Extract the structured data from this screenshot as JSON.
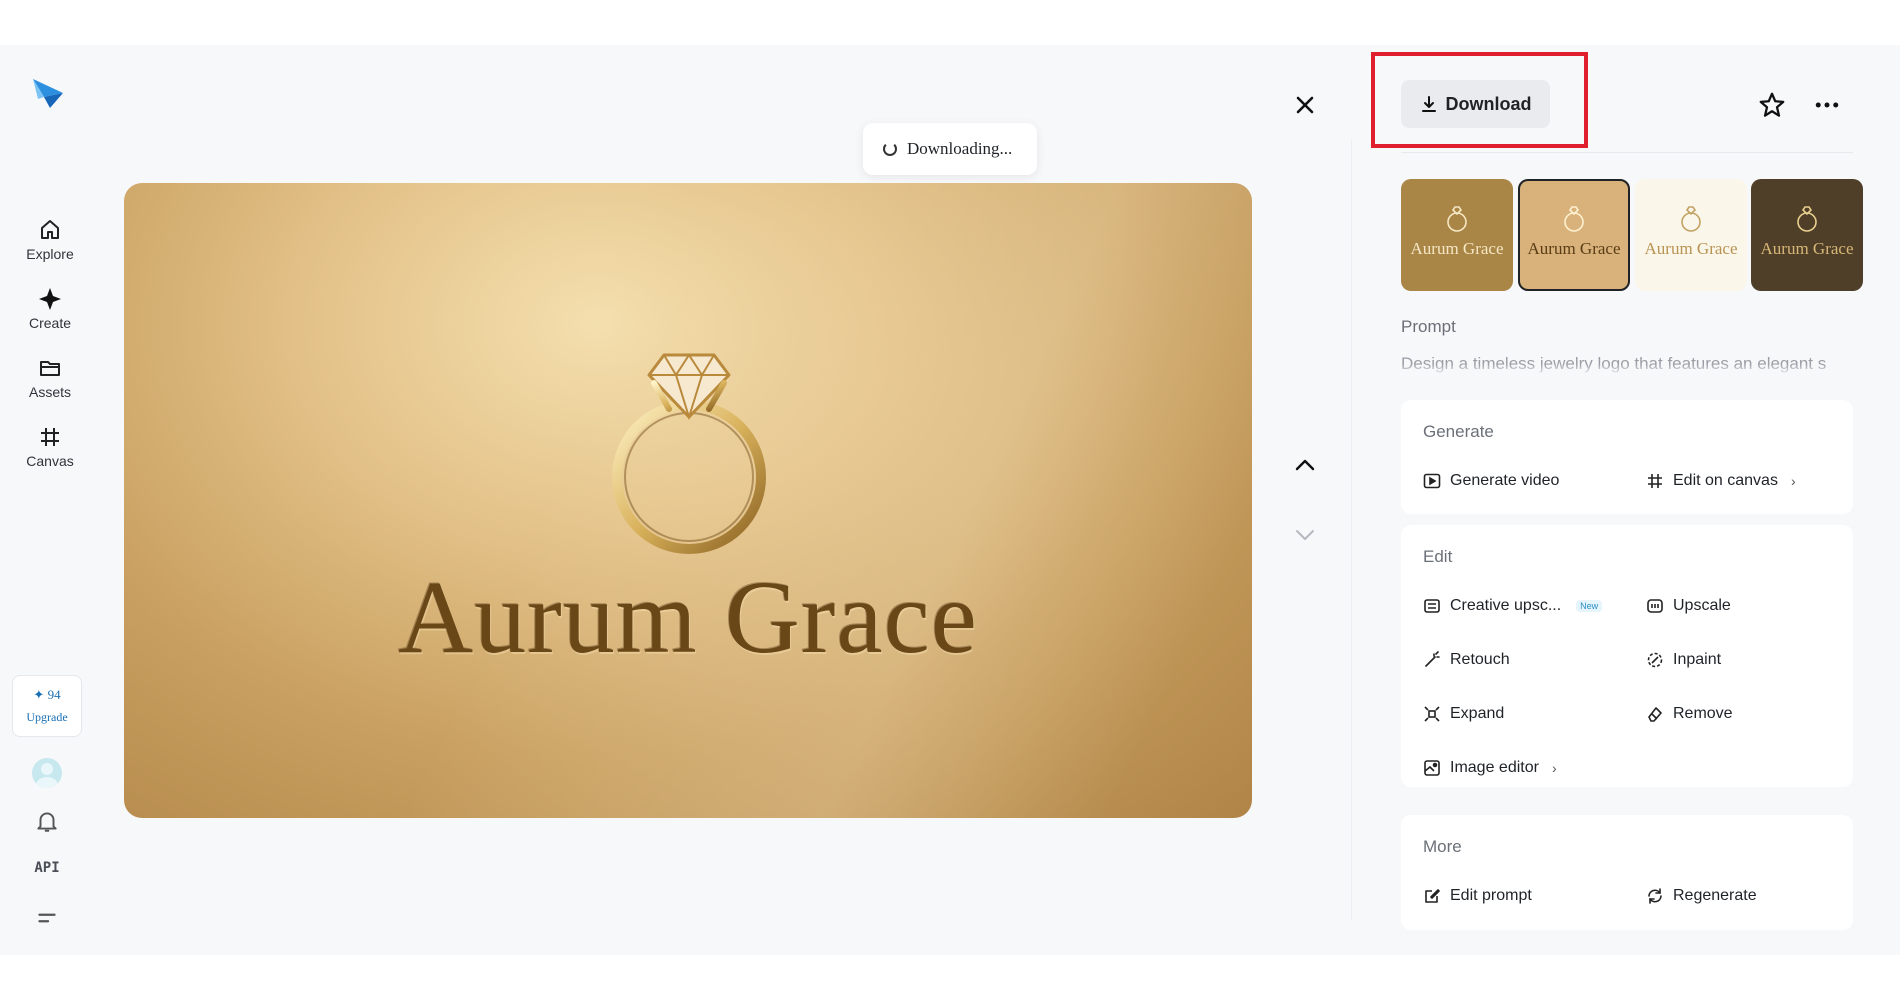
{
  "sidebar": {
    "items": [
      {
        "label": "Explore",
        "icon": "home-icon"
      },
      {
        "label": "Create",
        "icon": "sparkle-icon"
      },
      {
        "label": "Assets",
        "icon": "folder-icon"
      },
      {
        "label": "Canvas",
        "icon": "canvas-icon"
      }
    ],
    "credits": {
      "count": "✦ 94",
      "upgrade_label": "Upgrade"
    },
    "api_label": "API"
  },
  "viewer": {
    "toast": "Downloading...",
    "image_text": "Aurum Grace"
  },
  "header": {
    "download_label": "Download"
  },
  "thumbnails": [
    {
      "label": "Aurum Grace",
      "bg": "#a98546",
      "color": "#f6e7c4",
      "selected": false
    },
    {
      "label": "Aurum Grace",
      "bg": "#d8b27a",
      "color": "#5a3c16",
      "selected": true
    },
    {
      "label": "Aurum Grace",
      "bg": "#fbf6ea",
      "color": "#b89352",
      "selected": false
    },
    {
      "label": "Aurum Grace",
      "bg": "#4f3f28",
      "color": "#d7b777",
      "selected": false
    }
  ],
  "prompt": {
    "title": "Prompt",
    "text": "Design a timeless jewelry logo that features an elegant s"
  },
  "generate": {
    "title": "Generate",
    "video_label": "Generate video",
    "canvas_label": "Edit on canvas"
  },
  "edit": {
    "title": "Edit",
    "creative_upscale_label": "Creative upsc...",
    "new_badge": "New",
    "upscale_label": "Upscale",
    "retouch_label": "Retouch",
    "inpaint_label": "Inpaint",
    "expand_label": "Expand",
    "remove_label": "Remove",
    "image_editor_label": "Image editor"
  },
  "more": {
    "title": "More",
    "edit_prompt_label": "Edit prompt",
    "regenerate_label": "Regenerate"
  },
  "colors": {
    "highlight": "#e01e2e",
    "accent": "#1a6fb3",
    "gold_text": "#6a4717"
  }
}
